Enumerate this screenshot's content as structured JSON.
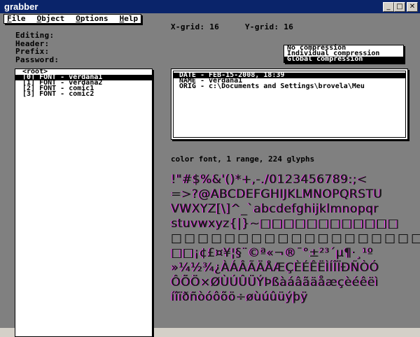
{
  "window": {
    "title": "grabber"
  },
  "menu": [
    "File",
    "Object",
    "Options",
    "Help"
  ],
  "labels": {
    "editing": "Editing:",
    "header": "Header:",
    "prefix": "Prefix:",
    "password": "Password:",
    "xgrid": "X-grid: 16",
    "ygrid": "Y-grid: 16"
  },
  "compression": {
    "options": [
      "No compression",
      "Individual compression",
      "Global compression"
    ],
    "selected": "Global compression"
  },
  "tree": {
    "root": "<root>",
    "items": [
      "[0] FONT - verdana1",
      "[1] FONT - verdana2",
      "[2] FONT - comic1",
      "[3] FONT - comic2"
    ],
    "selected_index": 0
  },
  "properties": {
    "rows": [
      "DATE - FEB-15-2008, 18:39",
      "NAME - verdana1",
      "ORIG - c:\\Documents and Settings\\brovela\\Meu"
    ],
    "selected_index": 0
  },
  "info": "color font, 1 range, 224 glyphs",
  "glyphs": {
    "rows": [
      " !\"#$%&'()*+,-./0123456789:;<",
      "=>?@ABCDEFGHIJKLMNOPQRSTU",
      "VWXYZ[\\]^_`abcdefghijklmnopqr",
      "stuvwxyz{|}~□□□□□□□□□□□□",
      "□□□□□□□□□□□□□□□□□□□□",
      "□□¡¢£¤¥¦§¨©ª«¬­®¯°±²³´µ¶·¸¹º",
      "»¼½¾¿ÀÁÂÃÄÅÆÇÈÉÊËÌÍÎÏÐÑÒÓ",
      "ÔÕÖ×ØÙÚÛÜÝÞßàáâãäåæçèéêëì",
      "íîïðñòóôõö÷øùúûüýþÿ"
    ]
  }
}
